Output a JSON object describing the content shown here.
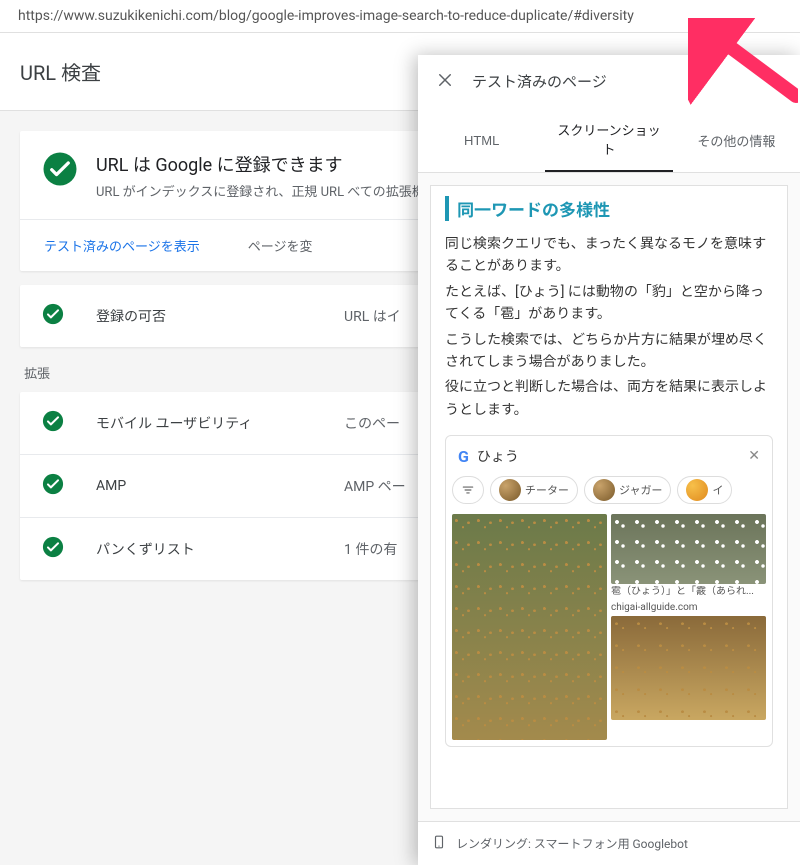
{
  "url": "https://www.suzukikenichi.com/blog/google-improves-image-search-to-reduce-duplicate/#diversity",
  "page_title": "URL 検査",
  "main": {
    "headline": "URL は Google に登録できます",
    "description": "URL がインデックスに登録され、正規 URL べての拡張機能とともに Google 検索結果に",
    "actions": {
      "view_tested": "テスト済みのページを表示",
      "change_page": "ページを変"
    }
  },
  "registration": {
    "label": "登録の可否",
    "value": "URL はイ"
  },
  "ext_label": "拡張",
  "ext_rows": [
    {
      "label": "モバイル ユーザビリティ",
      "value": "このペー"
    },
    {
      "label": "AMP",
      "value": "AMP ペー"
    },
    {
      "label": "パンくずリスト",
      "value": "1 件の有"
    }
  ],
  "panel": {
    "title": "テスト済みのページ",
    "tabs": [
      "HTML",
      "スクリーンショット",
      "その他の情報"
    ],
    "active_tab": 1,
    "footer": "レンダリング: スマートフォン用 Googlebot"
  },
  "screenshot": {
    "heading": "同一ワードの多様性",
    "paragraphs": [
      "同じ検索クエリでも、まったく異なるモノを意味することがあります。",
      "たとえば、[ひょう] には動物の「豹」と空から降ってくる「雹」があります。",
      "こうした検索では、どちらか片方に結果が埋め尽くされてしまう場合がありました。",
      "役に立つと判断した場合は、両方を結果に表示しようとします。"
    ],
    "search_query": "ひょう",
    "chips": [
      "チーター",
      "ジャガー",
      "イ"
    ],
    "caption1": "雹（ひょう）」と「霰（あられ...",
    "caption2": "chigai-allguide.com"
  }
}
